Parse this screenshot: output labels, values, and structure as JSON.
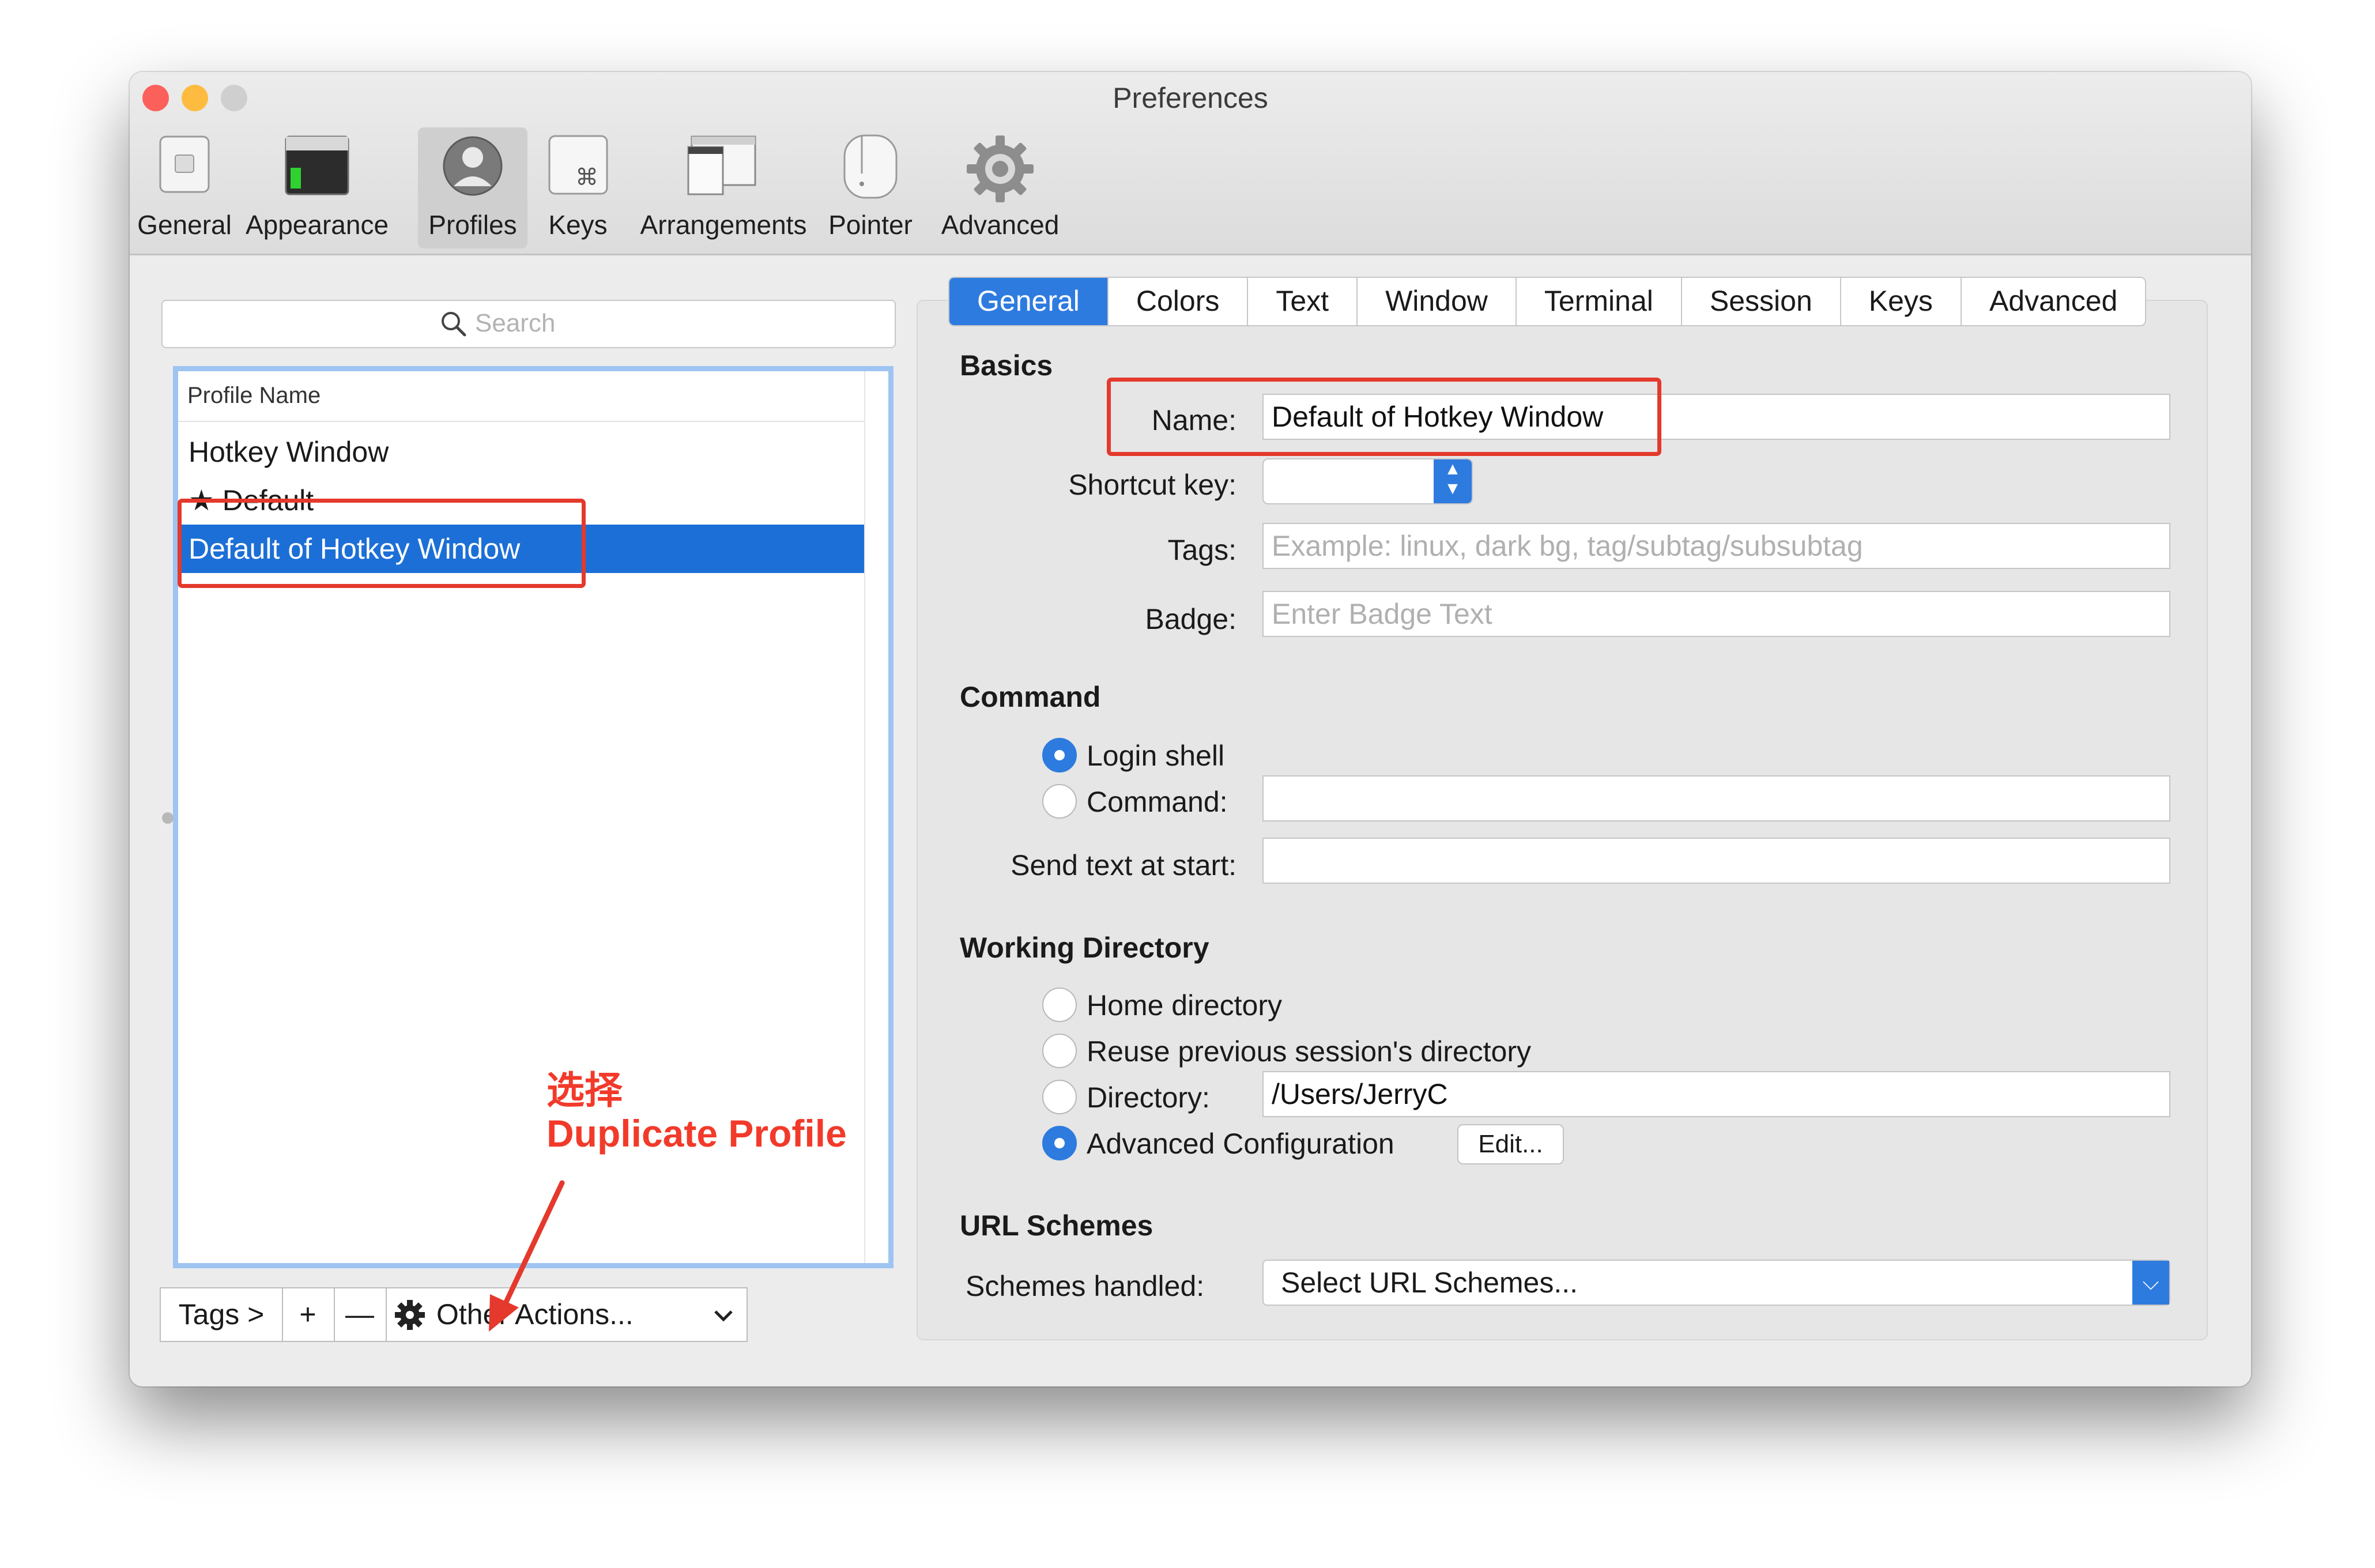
{
  "window": {
    "title": "Preferences",
    "traffic_lights": [
      "#fc605b",
      "#fdbc40",
      "#cfcfcf"
    ]
  },
  "toolbar": {
    "items": [
      {
        "label": "General",
        "icon": "switch-icon"
      },
      {
        "label": "Appearance",
        "icon": "terminal-window-icon"
      },
      {
        "label": "Profiles",
        "icon": "profile-user-icon"
      },
      {
        "label": "Keys",
        "icon": "command-key-icon"
      },
      {
        "label": "Arrangements",
        "icon": "window-arrangement-icon"
      },
      {
        "label": "Pointer",
        "icon": "mouse-icon"
      },
      {
        "label": "Advanced",
        "icon": "gear-icon"
      }
    ],
    "selected": "Profiles"
  },
  "profiles": {
    "search_placeholder": "Search",
    "column_header": "Profile Name",
    "rows": [
      {
        "name": "Hotkey Window"
      },
      {
        "name": "★ Default"
      },
      {
        "name": "Default of Hotkey Window"
      }
    ],
    "selected": "Default of Hotkey Window",
    "bottom_bar": {
      "tags": "Tags >",
      "add": "+",
      "remove": "—",
      "other_actions": "Other Actions..."
    }
  },
  "tabs": {
    "items": [
      "General",
      "Colors",
      "Text",
      "Window",
      "Terminal",
      "Session",
      "Keys",
      "Advanced"
    ],
    "selected": "General"
  },
  "basics": {
    "heading": "Basics",
    "name_label": "Name:",
    "name_value": "Default of Hotkey Window",
    "shortcut_label": "Shortcut key:",
    "tags_label": "Tags:",
    "tags_placeholder": "Example: linux, dark bg, tag/subtag/subsubtag",
    "badge_label": "Badge:",
    "badge_placeholder": "Enter Badge Text"
  },
  "command": {
    "heading": "Command",
    "login_shell": "Login shell",
    "command_label": "Command:",
    "send_text_label": "Send text at start:",
    "selected": "Login shell"
  },
  "working_directory": {
    "heading": "Working Directory",
    "home": "Home directory",
    "reuse": "Reuse previous session's directory",
    "directory_label": "Directory:",
    "directory_value": "/Users/JerryC",
    "advanced": "Advanced Configuration",
    "edit": "Edit...",
    "selected": "Advanced Configuration"
  },
  "url_schemes": {
    "heading": "URL Schemes",
    "label": "Schemes handled:",
    "value": "Select URL Schemes..."
  },
  "annotation": {
    "line1": "选择",
    "line2": "Duplicate Profile",
    "color": "#e4392c"
  },
  "colors": {
    "accent": "#2e7be0",
    "selection": "#1c6fd6",
    "annotation_red": "#e4392c"
  }
}
